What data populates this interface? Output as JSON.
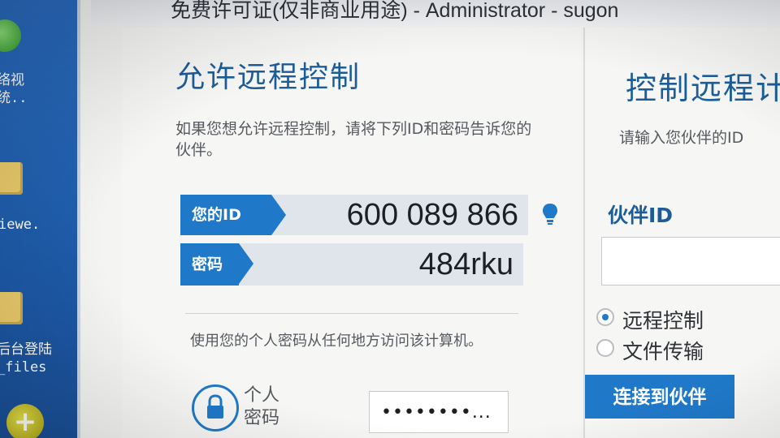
{
  "desktop": {
    "icons": [
      {
        "label": "络视\n统.."
      },
      {
        "label": "iewe."
      },
      {
        "label": "后台登陆\n_files"
      }
    ]
  },
  "window": {
    "title": "免费许可证(仅非商业用途) - Administrator - sugon"
  },
  "allow_remote": {
    "heading": "允许远程控制",
    "description": "如果您想允许远程控制，请将下列ID和密码告诉您的伙伴。",
    "id_label": "您的ID",
    "id_value": "600 089 866",
    "password_label": "密码",
    "password_value": "484rku",
    "personal_description": "使用您的个人密码从任何地方访问该计算机。",
    "personal_password_label": "个人\n密码",
    "personal_password_value": "••••••••..."
  },
  "control_remote": {
    "heading": "控制远程计",
    "description": "请输入您伙伴的ID",
    "partner_id_label": "伙伴ID",
    "partner_id_value": "",
    "options": [
      {
        "label": "远程控制",
        "selected": true
      },
      {
        "label": "文件传输",
        "selected": false
      }
    ],
    "connect_button": "连接到伙伴"
  },
  "colors": {
    "accent": "#1f78c8",
    "heading": "#1c5d98"
  }
}
